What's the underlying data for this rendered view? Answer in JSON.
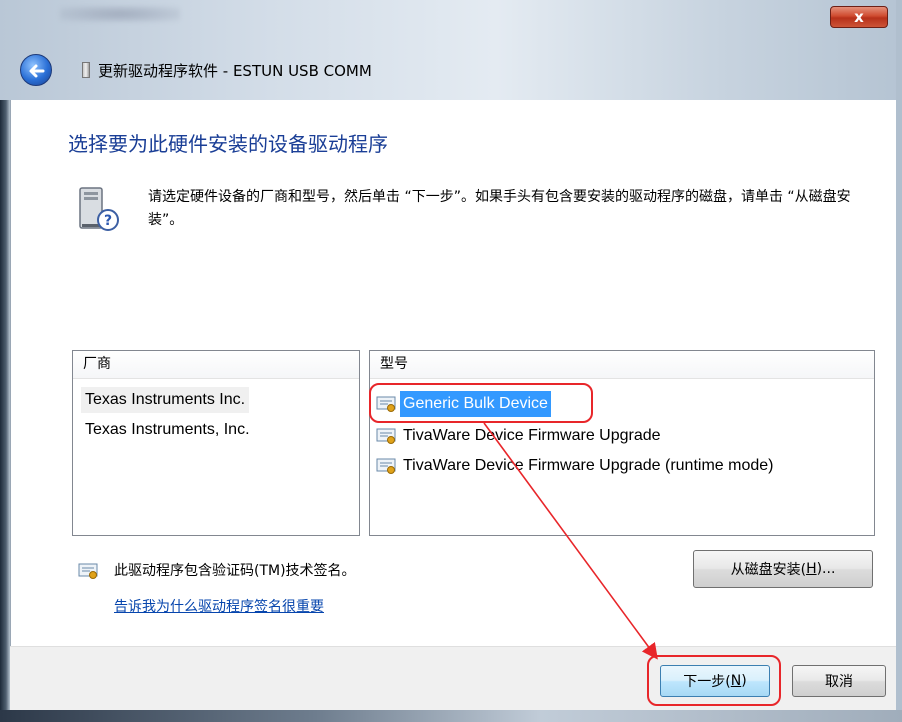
{
  "window": {
    "title": "更新驱动程序软件 - ESTUN USB COMM",
    "close_label": "x"
  },
  "page": {
    "heading": "选择要为此硬件安装的设备驱动程序",
    "description": "请选定硬件设备的厂商和型号，然后单击 “下一步”。如果手头有包含要安装的驱动程序的磁盘，请单击 “从磁盘安装”。"
  },
  "manufacturer_list": {
    "header": "厂商",
    "items": [
      {
        "label": "Texas Instruments Inc.",
        "selected": true
      },
      {
        "label": "Texas Instruments, Inc.",
        "selected": false
      }
    ]
  },
  "model_list": {
    "header": "型号",
    "items": [
      {
        "label": "Generic Bulk Device",
        "selected": true,
        "icon": "signed-driver-icon"
      },
      {
        "label": "TivaWare Device Firmware Upgrade",
        "selected": false,
        "icon": "signed-driver-icon"
      },
      {
        "label": "TivaWare Device Firmware Upgrade (runtime mode)",
        "selected": false,
        "icon": "signed-driver-icon"
      }
    ]
  },
  "signature": {
    "text": "此驱动程序包含验证码(TM)技术签名。",
    "link": "告诉我为什么驱动程序签名很重要"
  },
  "buttons": {
    "have_disk_prefix": "从磁盘安装(",
    "have_disk_key": "H",
    "have_disk_suffix": ")...",
    "next_prefix": "下一步(",
    "next_key": "N",
    "next_suffix": ")",
    "cancel": "取消"
  },
  "colors": {
    "heading": "#1a3e96",
    "selection": "#3399ff",
    "annotation": "#e8262a",
    "link": "#0645ad"
  }
}
